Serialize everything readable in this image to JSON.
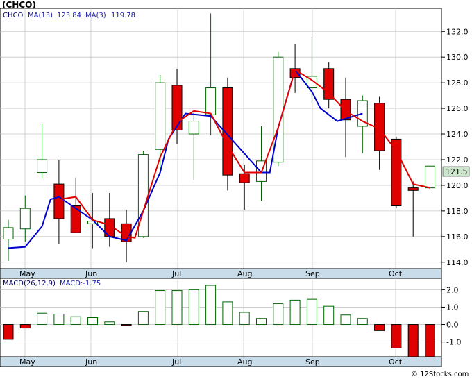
{
  "title": "(CHCO)",
  "credit": "© 12Stocks.com",
  "colors": {
    "background": "#ffffff",
    "axis_band": "#c8dcea",
    "grid": "#c8c8c8",
    "up_candle": "#006400",
    "down_candle": "#e00000",
    "ma13": "#0000cc",
    "ma3": "#e00000",
    "last_price_box": "#cce6cc"
  },
  "price_panel": {
    "legend": {
      "symbol": "CHCO",
      "ma13_label": "MA(13)",
      "ma13_value": "123.84",
      "ma3_label": "MA(3)",
      "ma3_value": "119.78"
    },
    "y_ticks": [
      "114.0",
      "116.0",
      "118.0",
      "120.0",
      "122.0",
      "124.0",
      "126.0",
      "128.0",
      "130.0",
      "132.0"
    ],
    "last_price": "121.5"
  },
  "macd_panel": {
    "legend": {
      "label": "MACD(26,12,9)",
      "value_label": "MACD:-1.75"
    },
    "y_ticks": [
      "-1.0",
      "0.0",
      "1.0",
      "2.0"
    ]
  },
  "x_axis": {
    "labels": [
      "May",
      "Jun",
      "Jul",
      "Aug",
      "Sep",
      "Oct"
    ]
  },
  "chart_data": {
    "type": "candlestick",
    "period": "weekly",
    "ylim": [
      113.5,
      133.8
    ],
    "macd_ylim": [
      -1.85,
      2.65
    ],
    "candles": [
      {
        "o": 115.8,
        "h": 117.3,
        "l": 114.1,
        "c": 116.7
      },
      {
        "o": 116.6,
        "h": 119.2,
        "l": 115.6,
        "c": 118.2
      },
      {
        "o": 121.0,
        "h": 124.8,
        "l": 120.5,
        "c": 122.0
      },
      {
        "o": 120.1,
        "h": 122.0,
        "l": 115.4,
        "c": 117.4
      },
      {
        "o": 118.4,
        "h": 120.6,
        "l": 116.4,
        "c": 116.3
      },
      {
        "o": 117.0,
        "h": 119.4,
        "l": 115.1,
        "c": 117.2
      },
      {
        "o": 117.4,
        "h": 119.4,
        "l": 115.2,
        "c": 116.0
      },
      {
        "o": 117.0,
        "h": 118.1,
        "l": 114.0,
        "c": 115.6
      },
      {
        "o": 116.0,
        "h": 122.7,
        "l": 115.9,
        "c": 122.4
      },
      {
        "o": 122.8,
        "h": 128.6,
        "l": 121.2,
        "c": 128.0
      },
      {
        "o": 127.8,
        "h": 129.1,
        "l": 123.2,
        "c": 124.3
      },
      {
        "o": 124.0,
        "h": 125.9,
        "l": 120.4,
        "c": 125.0
      },
      {
        "o": 125.5,
        "h": 133.4,
        "l": 123.9,
        "c": 127.6
      },
      {
        "o": 127.6,
        "h": 128.4,
        "l": 119.6,
        "c": 120.8
      },
      {
        "o": 120.9,
        "h": 121.6,
        "l": 118.1,
        "c": 120.2
      },
      {
        "o": 120.3,
        "h": 124.6,
        "l": 118.8,
        "c": 121.9
      },
      {
        "o": 121.8,
        "h": 130.4,
        "l": 121.5,
        "c": 130.0
      },
      {
        "o": 129.1,
        "h": 131.0,
        "l": 127.2,
        "c": 128.4
      },
      {
        "o": 127.6,
        "h": 131.6,
        "l": 126.4,
        "c": 128.5
      },
      {
        "o": 129.1,
        "h": 129.6,
        "l": 126.0,
        "c": 126.7
      },
      {
        "o": 126.7,
        "h": 128.4,
        "l": 122.2,
        "c": 125.1
      },
      {
        "o": 124.6,
        "h": 127.0,
        "l": 122.5,
        "c": 126.6
      },
      {
        "o": 126.4,
        "h": 126.9,
        "l": 121.2,
        "c": 122.7
      },
      {
        "o": 123.6,
        "h": 123.8,
        "l": 118.2,
        "c": 118.4
      },
      {
        "o": 119.8,
        "h": 120.3,
        "l": 116.0,
        "c": 119.6
      },
      {
        "o": 119.8,
        "h": 121.7,
        "l": 119.4,
        "c": 121.5
      }
    ],
    "ma13": [
      115.1,
      115.2,
      115.5,
      115.6,
      115.6,
      115.7,
      115.7,
      115.7,
      118.0,
      120.1,
      121.8,
      123.1,
      124.0,
      124.6,
      125.3,
      125.6
    ],
    "ma13_start_index": 10,
    "ma3": [
      115.1,
      116.7,
      118.9,
      119.1,
      117.3,
      116.9,
      116.0,
      116.3,
      118.0,
      122.1,
      124.9,
      125.8,
      125.6,
      123.1,
      121.0,
      121.0,
      124.5,
      129.0,
      128.2,
      127.2,
      125.8,
      125.0,
      124.4,
      122.7,
      120.1,
      119.8
    ],
    "ma13_full": [
      115.1,
      115.2,
      115.5,
      115.6,
      115.6,
      115.7,
      115.7,
      115.7,
      118.0,
      120.1,
      121.8,
      123.1,
      124.0,
      124.6,
      125.3,
      125.6
    ],
    "ma_blue": [
      115.1,
      115.2,
      116.8,
      118.9,
      119.1,
      117.3,
      116.0,
      115.7,
      118.0,
      121.0,
      123.6,
      125.6,
      125.4,
      123.2,
      121.0,
      121.0,
      124.5,
      129.0,
      127.3,
      126.0,
      125.0,
      125.4,
      125.6
    ],
    "ma_blue_x": [
      0,
      1,
      2,
      2.5,
      3,
      5,
      6,
      7,
      8,
      9,
      9.5,
      10.5,
      12,
      13.5,
      15,
      15.5,
      16,
      17,
      18,
      18.5,
      19.5,
      20.5,
      21
    ],
    "ma_red": [
      118.9,
      119.1,
      117.3,
      116.9,
      116.0,
      115.9,
      118.0,
      122.2,
      124.9,
      125.8,
      125.6,
      123.1,
      121.0,
      121.0,
      124.5,
      129.0,
      128.2,
      127.2,
      125.8,
      125.0,
      124.4,
      122.7,
      120.1,
      119.8
    ],
    "ma_red_x": [
      3,
      4,
      5,
      6,
      7,
      7.5,
      8,
      9,
      10,
      11,
      12,
      13,
      14,
      15,
      16,
      17,
      18,
      19,
      20,
      21,
      22,
      23,
      24,
      25
    ],
    "macd_hist": [
      -0.85,
      -0.2,
      0.65,
      0.6,
      0.45,
      0.4,
      0.15,
      -0.05,
      0.75,
      1.95,
      1.95,
      2.0,
      2.25,
      1.3,
      0.7,
      0.35,
      1.2,
      1.4,
      1.45,
      1.05,
      0.55,
      0.35,
      -0.35,
      -1.35,
      -1.85,
      -1.85
    ]
  }
}
